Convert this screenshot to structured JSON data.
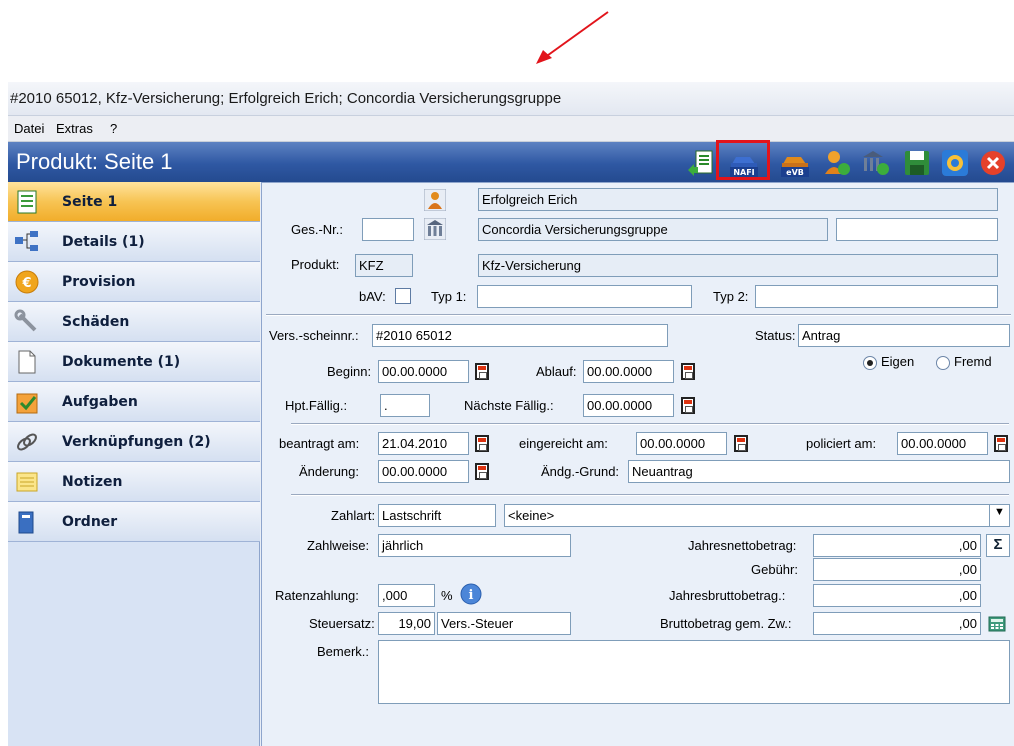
{
  "window": {
    "title": "#2010 65012, Kfz-Versicherung; Erfolgreich Erich; Concordia Versicherungsgruppe"
  },
  "menu": {
    "items": [
      "Datei",
      "Extras",
      "?"
    ]
  },
  "header": {
    "title": "Produkt: Seite 1"
  },
  "toolbar": {
    "buttons": [
      {
        "icon": "document-export-icon"
      },
      {
        "icon": "car-nafi-icon",
        "label": "NAFI",
        "highlighted": true
      },
      {
        "icon": "car-evb-icon",
        "label": "eVB"
      },
      {
        "icon": "person-export-icon"
      },
      {
        "icon": "building-export-icon"
      },
      {
        "icon": "save-icon"
      },
      {
        "icon": "refresh-icon"
      },
      {
        "icon": "close-icon"
      }
    ],
    "highlight_color": "#e2141b"
  },
  "sidebar": {
    "items": [
      {
        "label": "Seite 1",
        "icon": "page-icon",
        "active": true
      },
      {
        "label": "Details (1)",
        "icon": "hierarchy-icon"
      },
      {
        "label": "Provision",
        "icon": "euro-coin-icon"
      },
      {
        "label": "Schäden",
        "icon": "wrench-icon"
      },
      {
        "label": "Dokumente (1)",
        "icon": "document-icon"
      },
      {
        "label": "Aufgaben",
        "icon": "checkbox-task-icon"
      },
      {
        "label": "Verknüpfungen (2)",
        "icon": "link-icon"
      },
      {
        "label": "Notizen",
        "icon": "notes-icon"
      },
      {
        "label": "Ordner",
        "icon": "folder-icon"
      }
    ]
  },
  "form": {
    "customer": "Erfolgreich Erich",
    "ges_nr_label": "Ges.-Nr.:",
    "ges_nr": "",
    "company": "Concordia Versicherungsgruppe",
    "company_extra": "",
    "produkt_label": "Produkt:",
    "produkt_code": "KFZ",
    "produkt_name": "Kfz-Versicherung",
    "bav_label": "bAV:",
    "typ1_label": "Typ 1:",
    "typ1": "",
    "typ2_label": "Typ 2:",
    "typ2": "",
    "vsnr_label": "Vers.-scheinnr.:",
    "vsnr": "#2010 65012",
    "status_label": "Status:",
    "status": "Antrag",
    "eigen_label": "Eigen",
    "fremd_label": "Fremd",
    "beginn_label": "Beginn:",
    "beginn": "00.00.0000",
    "ablauf_label": "Ablauf:",
    "ablauf": "00.00.0000",
    "hpt_label": "Hpt.Fällig.:",
    "hpt": ".",
    "naechste_label": "Nächste Fällig.:",
    "naechste": "00.00.0000",
    "beantragt_label": "beantragt am:",
    "beantragt": "21.04.2010",
    "eingereicht_label": "eingereicht am:",
    "eingereicht": "00.00.0000",
    "policiert_label": "policiert am:",
    "policiert": "00.00.0000",
    "aenderung_label": "Änderung:",
    "aenderung": "00.00.0000",
    "aendgrund_label": "Ändg.-Grund:",
    "aendgrund": "Neuantrag",
    "zahlart_label": "Zahlart:",
    "zahlart": "Lastschrift",
    "zahlart_option": "<keine>",
    "zahlweise_label": "Zahlweise:",
    "zahlweise": "jährlich",
    "jahresnetto_label": "Jahresnettobetrag:",
    "jahresnetto": ",00",
    "gebuehr_label": "Gebühr:",
    "gebuehr": ",00",
    "ratenzahlung_label": "Ratenzahlung:",
    "ratenzahlung": ",000",
    "percent_sign": "%",
    "jahresbrutto_label": "Jahresbruttobetrag.:",
    "jahresbrutto": ",00",
    "steuersatz_label": "Steuersatz:",
    "steuersatz": "19,00",
    "steuer_name": "Vers.-Steuer",
    "bruttogem_label": "Bruttobetrag gem. Zw.:",
    "bruttogem": ",00",
    "bemerk_label": "Bemerk.:",
    "bemerk": ""
  }
}
